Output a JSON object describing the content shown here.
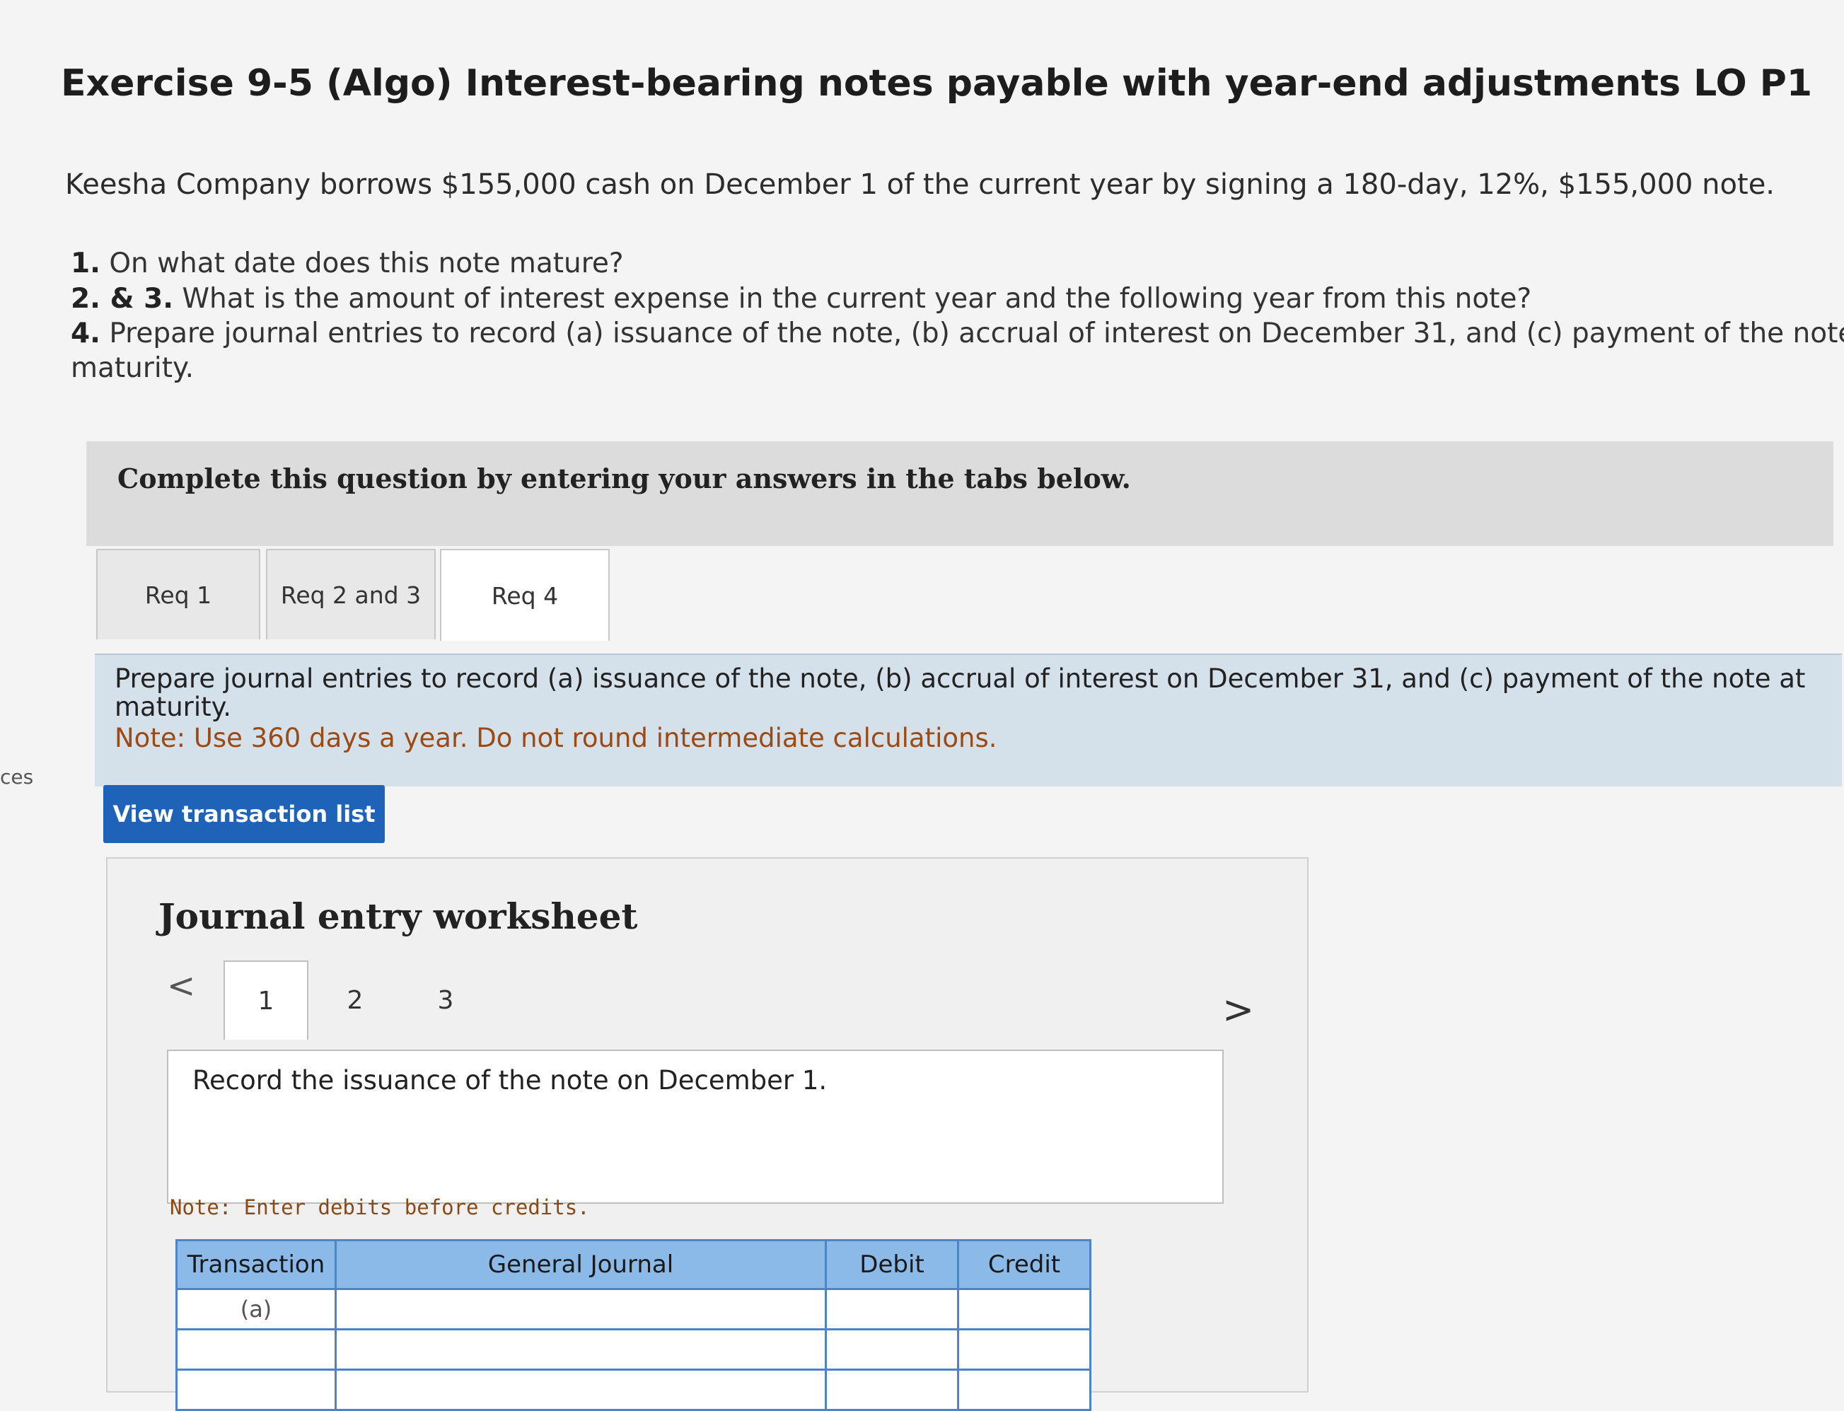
{
  "side_label": "ces",
  "title": "Exercise 9-5 (Algo) Interest-bearing notes payable with year-end adjustments LO P1",
  "intro": "Keesha Company borrows $155,000 cash on December 1 of the current year by signing a 180-day, 12%, $155,000 note.",
  "questions": [
    {
      "num": "1.",
      "text": " On what date does this note mature?"
    },
    {
      "num": "2. & 3.",
      "text": " What is the amount of interest expense in the current year and the following year from this note?"
    },
    {
      "num": "4.",
      "text": " Prepare journal entries to record (a) issuance of the note, (b) accrual of interest on December 31, and (c) payment of the note at"
    },
    {
      "text": "maturity."
    }
  ],
  "banner": "Complete this question by entering your answers in the tabs below.",
  "tabs": [
    {
      "label": "Req 1"
    },
    {
      "label": "Req 2 and 3"
    },
    {
      "label": "Req 4"
    }
  ],
  "instructions": {
    "line1": "Prepare journal entries to record (a) issuance of the note, (b) accrual of interest on December 31, and (c) payment of the note at",
    "line2": "maturity.",
    "note": "Note: Use 360 days a year. Do not round intermediate calculations."
  },
  "view_button": "View transaction list",
  "worksheet": {
    "title": "Journal entry worksheet",
    "prev": "<",
    "next": ">",
    "pages": [
      "1",
      "2",
      "3"
    ],
    "record_text": "Record the issuance of the note on December 1.",
    "note": "Note: Enter debits before credits.",
    "table": {
      "headers": [
        "Transaction",
        "General Journal",
        "Debit",
        "Credit"
      ],
      "rows": [
        {
          "transaction": "(a)"
        },
        {
          "transaction": ""
        },
        {
          "transaction": ""
        }
      ]
    }
  },
  "colors": {
    "button": "#1f63b8",
    "header_blue": "#8bb9e8",
    "note_brown": "#9b4a14",
    "instruction_bg": "#d5e1ea"
  }
}
